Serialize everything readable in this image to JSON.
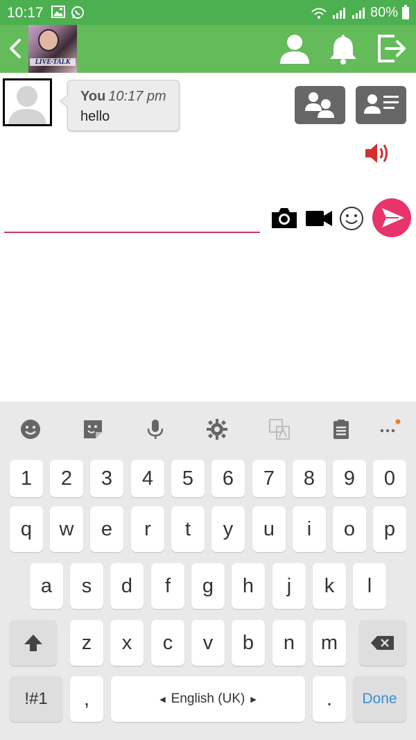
{
  "status_bar": {
    "time": "10:17",
    "battery": "80%"
  },
  "app_bar": {
    "avatar_logo": "LIVE·TALK"
  },
  "message": {
    "sender": "You",
    "time": "10:17 pm",
    "text": "hello"
  },
  "composer": {
    "value": "",
    "placeholder": ""
  },
  "keyboard": {
    "row_numbers": [
      "1",
      "2",
      "3",
      "4",
      "5",
      "6",
      "7",
      "8",
      "9",
      "0"
    ],
    "row1": [
      "q",
      "w",
      "e",
      "r",
      "t",
      "y",
      "u",
      "i",
      "o",
      "p"
    ],
    "row2": [
      "a",
      "s",
      "d",
      "f",
      "g",
      "h",
      "j",
      "k",
      "l"
    ],
    "row3": [
      "z",
      "x",
      "c",
      "v",
      "b",
      "n",
      "m"
    ],
    "symbols_label": "!#1",
    "comma": ",",
    "space_label": "English (UK)",
    "period": ".",
    "done_label": "Done"
  },
  "colors": {
    "status_bar": "#4caf50",
    "app_bar": "#63bb5a",
    "accent": "#e8336b",
    "input_underline": "#cc3366",
    "speaker": "#d32f2f",
    "done": "#3a8ed6"
  }
}
